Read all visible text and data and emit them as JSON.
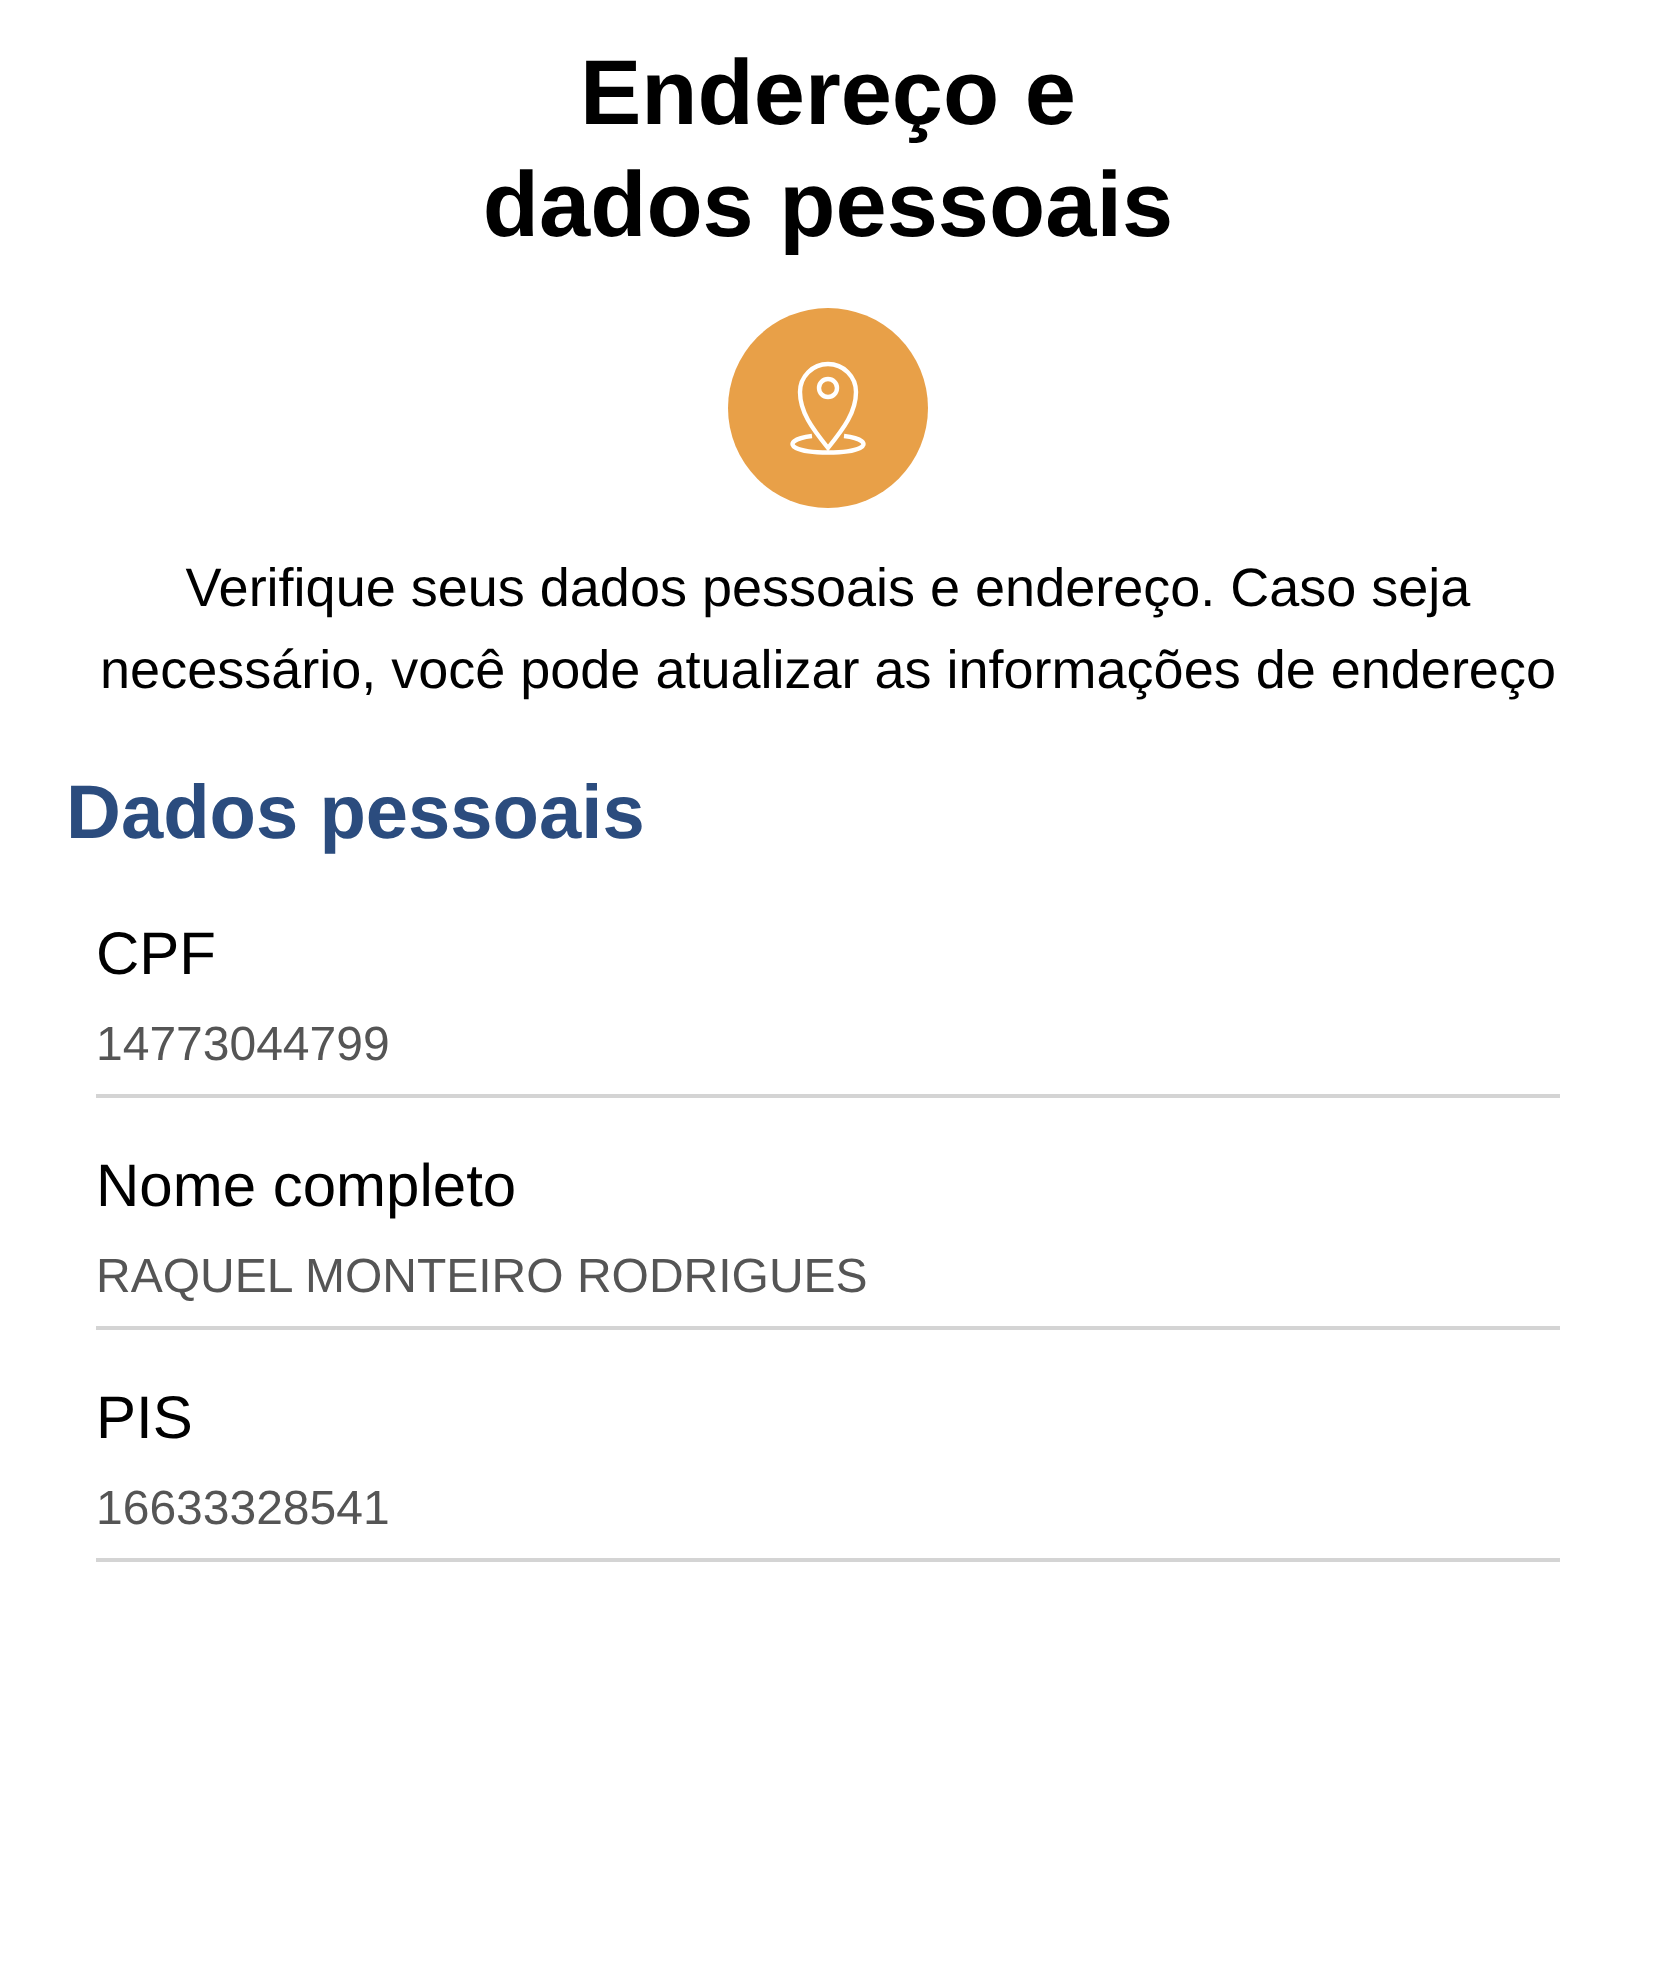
{
  "title": "Endereço e\ndados pessoais",
  "description": "Verifique seus dados pessoais e endereço. Caso seja necessário, você pode atualizar as informações de endereço",
  "section_title": "Dados pessoais",
  "fields": [
    {
      "label": "CPF",
      "value": "14773044799"
    },
    {
      "label": "Nome completo",
      "value": "RAQUEL MONTEIRO RODRIGUES"
    },
    {
      "label": "PIS",
      "value": "16633328541"
    }
  ]
}
